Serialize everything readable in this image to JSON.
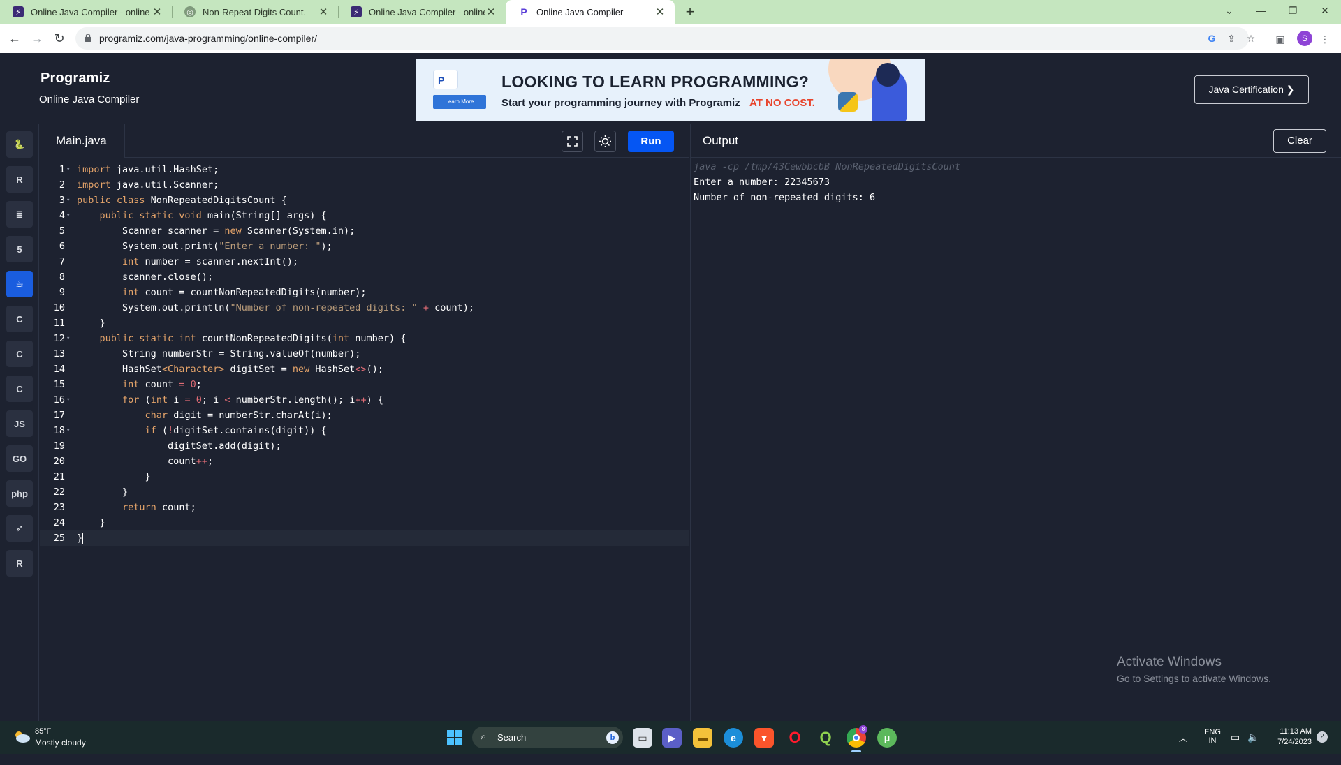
{
  "browser": {
    "tabs": [
      {
        "title": "Online Java Compiler - online ed",
        "favicon": "bolt-icon",
        "active": false
      },
      {
        "title": "Non-Repeat Digits Count.",
        "favicon": "chatgpt-icon",
        "active": false
      },
      {
        "title": "Online Java Compiler - online ed",
        "favicon": "bolt-icon",
        "active": false
      },
      {
        "title": "Online Java Compiler",
        "favicon": "programiz-icon",
        "active": true
      }
    ],
    "new_tab": "+",
    "url": "programiz.com/java-programming/online-compiler/",
    "profile_initial": "S"
  },
  "site": {
    "logo": "Programiz",
    "subtitle": "Online Java Compiler",
    "certification_button": "Java Certification ❯",
    "ad": {
      "badge": "P",
      "learn_more": "Learn More",
      "headline": "LOOKING TO LEARN PROGRAMMING?",
      "tagline": "Start your programming journey with Programiz",
      "tagline_highlight": "AT NO COST.",
      "accent": "#e8442c"
    }
  },
  "sidebar": {
    "languages": [
      {
        "name": "python",
        "glyph": "🐍",
        "active": false
      },
      {
        "name": "r",
        "glyph": "R",
        "active": false
      },
      {
        "name": "sql",
        "glyph": "≣",
        "active": false
      },
      {
        "name": "html",
        "glyph": "5",
        "active": false
      },
      {
        "name": "java",
        "glyph": "☕",
        "active": true
      },
      {
        "name": "c",
        "glyph": "C",
        "active": false
      },
      {
        "name": "cpp",
        "glyph": "C",
        "active": false
      },
      {
        "name": "csharp",
        "glyph": "C",
        "active": false
      },
      {
        "name": "javascript",
        "glyph": "JS",
        "active": false
      },
      {
        "name": "go",
        "glyph": "GO",
        "active": false
      },
      {
        "name": "php",
        "glyph": "php",
        "active": false
      },
      {
        "name": "swift",
        "glyph": "➶",
        "active": false
      },
      {
        "name": "rust",
        "glyph": "R",
        "active": false
      }
    ]
  },
  "editor": {
    "filename": "Main.java",
    "run_label": "Run",
    "current_line": 25,
    "lines": [
      {
        "n": "1",
        "fold": true,
        "html": "<span class=\"k\">import</span> java.util.HashSet;"
      },
      {
        "n": "2",
        "fold": false,
        "html": "<span class=\"k\">import</span> java.util.Scanner;"
      },
      {
        "n": "3",
        "fold": true,
        "html": "<span class=\"k\">public class</span> NonRepeatedDigitsCount {"
      },
      {
        "n": "4",
        "fold": true,
        "html": "    <span class=\"k\">public static void</span> main(String[] args) {"
      },
      {
        "n": "5",
        "fold": false,
        "html": "        Scanner scanner = <span class=\"k\">new</span> Scanner(System.in);"
      },
      {
        "n": "6",
        "fold": false,
        "html": "        System.out.print(<span class=\"s\">\"Enter a number: \"</span>);"
      },
      {
        "n": "7",
        "fold": false,
        "html": "        <span class=\"k\">int</span> number = scanner.nextInt();"
      },
      {
        "n": "8",
        "fold": false,
        "html": "        scanner.close();"
      },
      {
        "n": "9",
        "fold": false,
        "html": "        <span class=\"k\">int</span> count = countNonRepeatedDigits(number);"
      },
      {
        "n": "10",
        "fold": false,
        "html": "        System.out.println(<span class=\"s\">\"Number of non-repeated digits: \"</span> <span class=\"o\">+</span> count);"
      },
      {
        "n": "11",
        "fold": false,
        "html": "    }"
      },
      {
        "n": "12",
        "fold": true,
        "html": "    <span class=\"k\">public static int</span> countNonRepeatedDigits(<span class=\"k\">int</span> number) {"
      },
      {
        "n": "13",
        "fold": false,
        "html": "        String numberStr = String.valueOf(number);"
      },
      {
        "n": "14",
        "fold": false,
        "html": "        HashSet<span class=\"k\">&lt;Character&gt;</span> digitSet = <span class=\"k\">new</span> HashSet<span class=\"o\">&lt;&gt;</span>();"
      },
      {
        "n": "15",
        "fold": false,
        "html": "        <span class=\"k\">int</span> count <span class=\"o\">=</span> <span class=\"o\">0</span>;"
      },
      {
        "n": "16",
        "fold": true,
        "html": "        <span class=\"k\">for</span> (<span class=\"k\">int</span> i <span class=\"o\">=</span> <span class=\"o\">0</span>; i <span class=\"o\">&lt;</span> numberStr.length(); i<span class=\"o\">++</span>) {"
      },
      {
        "n": "17",
        "fold": false,
        "html": "            <span class=\"k\">char</span> digit = numberStr.charAt(i);"
      },
      {
        "n": "18",
        "fold": true,
        "html": "            <span class=\"k\">if</span> (<span class=\"o\">!</span>digitSet.contains(digit)) {"
      },
      {
        "n": "19",
        "fold": false,
        "html": "                digitSet.add(digit);"
      },
      {
        "n": "20",
        "fold": false,
        "html": "                count<span class=\"o\">++</span>;"
      },
      {
        "n": "21",
        "fold": false,
        "html": "            }"
      },
      {
        "n": "22",
        "fold": false,
        "html": "        }"
      },
      {
        "n": "23",
        "fold": false,
        "html": "        <span class=\"k\">return</span> count;"
      },
      {
        "n": "24",
        "fold": false,
        "html": "    }"
      },
      {
        "n": "25",
        "fold": false,
        "html": "}<span class=\"cursor\"></span>"
      }
    ]
  },
  "output": {
    "title": "Output",
    "clear_label": "Clear",
    "command": "java -cp /tmp/43CewbbcbB NonRepeatedDigitsCount",
    "lines": [
      "Enter a number: 22345673",
      "Number of non-repeated digits: 6"
    ],
    "watermark_title": "Activate Windows",
    "watermark_sub": "Go to Settings to activate Windows."
  },
  "taskbar": {
    "weather_temp": "85°F",
    "weather_desc": "Mostly cloudy",
    "search_label": "Search",
    "lang_top": "ENG",
    "lang_bottom": "IN",
    "time": "11:13 AM",
    "date": "7/24/2023",
    "notification_count": "2",
    "chrome_badge": "8"
  }
}
